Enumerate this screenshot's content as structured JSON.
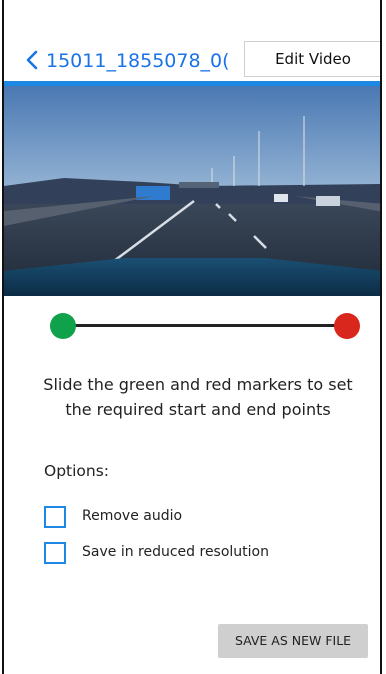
{
  "header": {
    "file_name": "15011_1855078_0(",
    "edit_button": "Edit Video",
    "accent_color": "#1e88e5"
  },
  "video": {
    "icon": "dashcam-video-frame"
  },
  "trim_slider": {
    "start_marker_color": "#0fa24b",
    "end_marker_color": "#d9271e"
  },
  "instructions": "Slide the green and red markers to set the required start and end points",
  "options": {
    "label": "Options:",
    "items": [
      {
        "label": "Remove audio",
        "checked": false
      },
      {
        "label": "Save in reduced resolution",
        "checked": false
      }
    ]
  },
  "actions": {
    "save": "SAVE AS NEW FILE"
  }
}
